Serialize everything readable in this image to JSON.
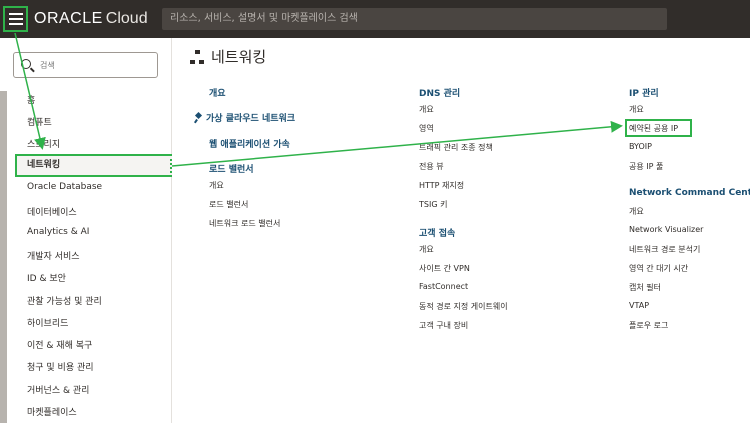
{
  "header": {
    "logo_oracle": "ORACLE",
    "logo_cloud": "Cloud",
    "search_placeholder": "리소스, 서비스, 설명서 및 마켓플레이스 검색"
  },
  "sidebar": {
    "search_placeholder": "검색",
    "items": [
      {
        "label": "홈"
      },
      {
        "label": "컴퓨트"
      },
      {
        "label": "스토리지"
      },
      {
        "label": "네트워킹"
      },
      {
        "label": "Oracle Database"
      },
      {
        "label": "데이터베이스"
      },
      {
        "label": "Analytics & AI"
      },
      {
        "label": "개발자 서비스"
      },
      {
        "label": "ID & 보안"
      },
      {
        "label": "관찰 가능성 및 관리"
      },
      {
        "label": "하이브리드"
      },
      {
        "label": "이전 & 재해 복구"
      },
      {
        "label": "청구 및 비용 관리"
      },
      {
        "label": "거버넌스 & 관리"
      },
      {
        "label": "마켓플레이스"
      }
    ]
  },
  "main": {
    "title": "네트워킹",
    "col1": {
      "overview": "개요",
      "vcn": "가상 클라우드 네트워크",
      "waf": "웹 애플리케이션 가속",
      "lb_head": "로드 밸런서",
      "lb_items": [
        "개요",
        "로드 밸런서",
        "네트워크 로드 밸런서"
      ]
    },
    "col2": {
      "dns_head": "DNS 관리",
      "dns_items": [
        "개요",
        "영역",
        "트래픽 관리 조종 정책",
        "전용 뷰",
        "HTTP 재지정",
        "TSIG 키"
      ],
      "cc_head": "고객 접속",
      "cc_items": [
        "개요",
        "사이트 간 VPN",
        "FastConnect",
        "동적 경로 지정 게이트웨이",
        "고객 구내 장비"
      ]
    },
    "col3": {
      "ip_head": "IP 관리",
      "ip_items": [
        "개요",
        "예약된 공용 IP",
        "BYOIP",
        "공용 IP 풀"
      ],
      "ncc_head": "Network Command Center",
      "ncc_items": [
        "개요",
        "Network Visualizer",
        "네트워크 경로 분석기",
        "영역 간 대기 시간",
        "캡처 필터",
        "VTAP",
        "플로우 로그"
      ]
    }
  },
  "colors": {
    "header_bg": "#312d2a",
    "annotation_green": "#2fb24a",
    "heading_blue": "#1b4f72"
  }
}
